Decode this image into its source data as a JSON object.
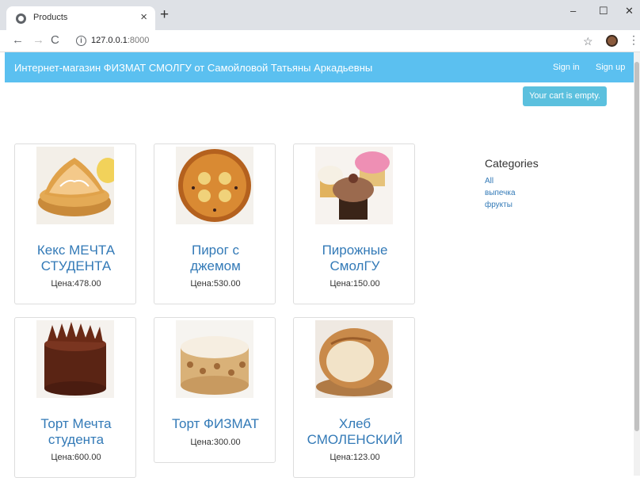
{
  "browser": {
    "tab_title": "Products",
    "url_host": "127.0.0.1",
    "url_port": ":8000"
  },
  "navbar": {
    "brand": "Интернет-магазин ФИЗМАТ СМОЛГУ от Самойловой Татьяны Аркадьевны",
    "sign_in": "Sign in",
    "sign_up": "Sign up"
  },
  "cart": {
    "label": "Your cart is empty."
  },
  "products": [
    {
      "name_line1": "Кекс МЕЧТА",
      "name_line2": "СТУДЕНТА",
      "price": "Цена:478.00"
    },
    {
      "name_line1": "Пирог с",
      "name_line2": "джемом",
      "price": "Цена:530.00"
    },
    {
      "name_line1": "Пирожные",
      "name_line2": "СмолГУ",
      "price": "Цена:150.00"
    },
    {
      "name_line1": "Торт Мечта",
      "name_line2": "студента",
      "price": "Цена:600.00"
    },
    {
      "name_line1": "Торт ФИЗМАТ",
      "name_line2": "",
      "price": "Цена:300.00"
    },
    {
      "name_line1": "Хлеб",
      "name_line2": "СМОЛЕНСКИЙ",
      "price": "Цена:123.00"
    }
  ],
  "categories": {
    "heading": "Categories",
    "items": [
      "All",
      "выпечка",
      "фрукты"
    ]
  }
}
